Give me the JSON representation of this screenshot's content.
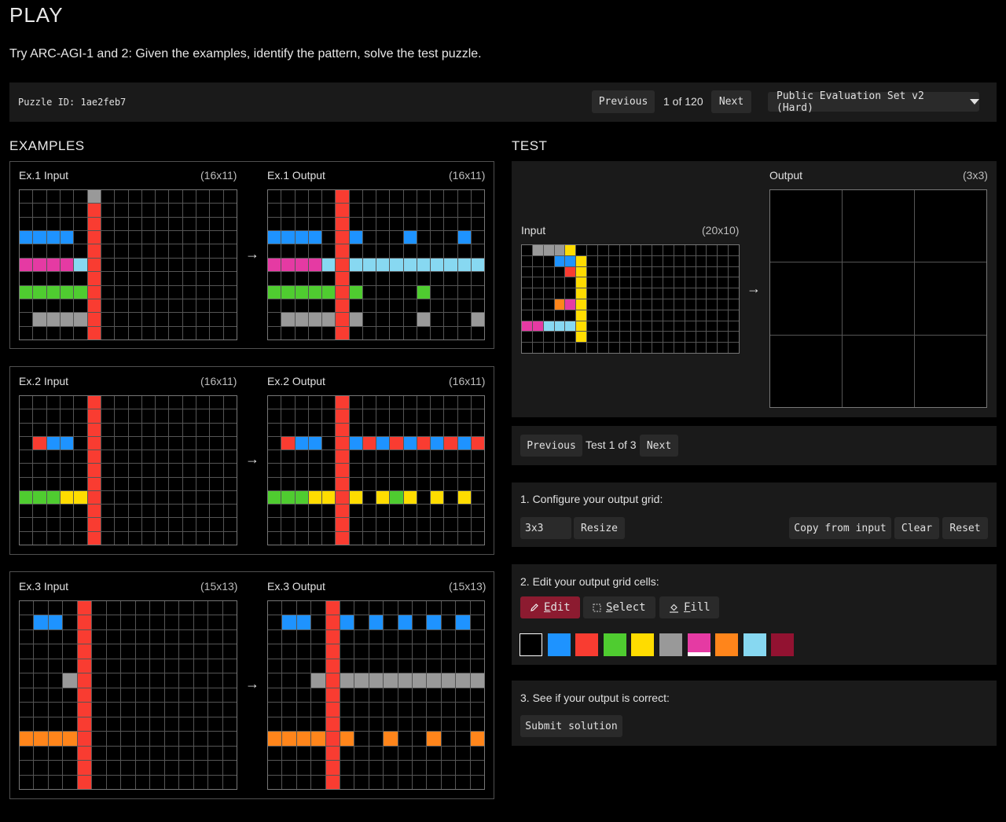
{
  "header": {
    "title": "PLAY",
    "subtitle": "Try ARC-AGI-1 and 2: Given the examples, identify the pattern, solve the test puzzle."
  },
  "topbar": {
    "puzzle_id": "Puzzle ID: 1ae2feb7",
    "previous_label": "Previous",
    "counter": "1 of 120",
    "next_label": "Next",
    "set_selector": "Public Evaluation Set v2 (Hard)"
  },
  "examples": {
    "heading": "EXAMPLES",
    "arrow": "→",
    "items": [
      {
        "input_label": "Ex.1 Input",
        "input_dims": "(16x11)",
        "output_label": "Ex.1 Output",
        "output_dims": "(16x11)"
      },
      {
        "input_label": "Ex.2 Input",
        "input_dims": "(16x11)",
        "output_label": "Ex.2 Output",
        "output_dims": "(16x11)"
      },
      {
        "input_label": "Ex.3 Input",
        "input_dims": "(15x13)",
        "output_label": "Ex.3 Output",
        "output_dims": "(15x13)"
      }
    ]
  },
  "test": {
    "heading": "TEST",
    "input_label": "Input",
    "input_dims": "(20x10)",
    "output_label": "Output",
    "output_dims": "(3x3)",
    "arrow": "→",
    "previous_label": "Previous",
    "counter": "Test 1 of 3",
    "next_label": "Next"
  },
  "configure": {
    "title": "1. Configure your output grid:",
    "size_value": "3x3",
    "resize_label": "Resize",
    "copy_label": "Copy from input",
    "clear_label": "Clear",
    "reset_label": "Reset"
  },
  "edit": {
    "title": "2. Edit your output grid cells:",
    "edit_first": "E",
    "edit_rest": "dit",
    "select_first": "S",
    "select_rest": "elect",
    "fill_first": "F",
    "fill_rest": "ill",
    "icons": {
      "edit": "pencil-icon",
      "select": "selection-box-icon",
      "fill": "paint-bucket-icon"
    }
  },
  "submit": {
    "title": "3. See if your output is correct:",
    "submit_label": "Submit solution"
  },
  "palette": [
    "#000000",
    "#1E93FF",
    "#F93C31",
    "#4FCC30",
    "#FFDC00",
    "#999999",
    "#E53AA3",
    "#FF851B",
    "#87D8F1",
    "#921231"
  ],
  "grids": {
    "ex1_in": {
      "w": 16,
      "h": 11,
      "rows": [
        "0000050000000000",
        "0000020000000000",
        "0000020000000000",
        "1111020000000000",
        "0000020000000000",
        "6666820000000000",
        "0000020000000000",
        "3333320000000000",
        "0000020000000000",
        "0555520000000000",
        "0000020000000000"
      ]
    },
    "ex1_out": {
      "w": 16,
      "h": 11,
      "rows": [
        "0000020000000000",
        "0000020000000000",
        "0000020000000000",
        "1111021000100010",
        "0000020000000000",
        "6666828888888888",
        "0000020000000000",
        "3333323000030000",
        "0000020000000000",
        "0555525000050005",
        "0000020000000000"
      ]
    },
    "ex2_in": {
      "w": 16,
      "h": 11,
      "rows": [
        "0000020000000000",
        "0000020000000000",
        "0000020000000000",
        "0211020000000000",
        "0000020000000000",
        "0000020000000000",
        "0000020000000000",
        "3334420000000000",
        "0000020000000000",
        "0000020000000000",
        "0000020000000000"
      ]
    },
    "ex2_out": {
      "w": 16,
      "h": 11,
      "rows": [
        "0000020000000000",
        "0000020000000000",
        "0000020000000000",
        "0211021212121212",
        "0000020000000000",
        "0000020000000000",
        "0000020000000000",
        "3334424043404040",
        "0000020000000000",
        "0000020000000000",
        "0000020000000000"
      ]
    },
    "ex3_in": {
      "w": 15,
      "h": 13,
      "rows": [
        "000020000000000",
        "011020000000000",
        "000020000000000",
        "000020000000000",
        "000020000000000",
        "000520000000000",
        "000020000000000",
        "000020000000000",
        "000020000000000",
        "777720000000000",
        "000020000000000",
        "000020000000000",
        "000020000000000"
      ]
    },
    "ex3_out": {
      "w": 15,
      "h": 13,
      "rows": [
        "000020000000000",
        "011021010101010",
        "000020000000000",
        "000020000000000",
        "000020000000000",
        "000525555555555",
        "000020000000000",
        "000020000000000",
        "000020000000000",
        "777727007007007",
        "000020000000000",
        "000020000000000",
        "000020000000000"
      ]
    },
    "test_in": {
      "w": 20,
      "h": 10,
      "rows": [
        "05554000000000000000",
        "00011400000000000000",
        "00002400000000000000",
        "00000400000000000000",
        "00000400000000000000",
        "00076400000000000000",
        "00000400000000000000",
        "66888400000000000000",
        "00000400000000000000",
        "00000000000000000000"
      ]
    },
    "test_out": {
      "w": 3,
      "h": 3,
      "rows": [
        "000",
        "000",
        "000"
      ]
    }
  }
}
